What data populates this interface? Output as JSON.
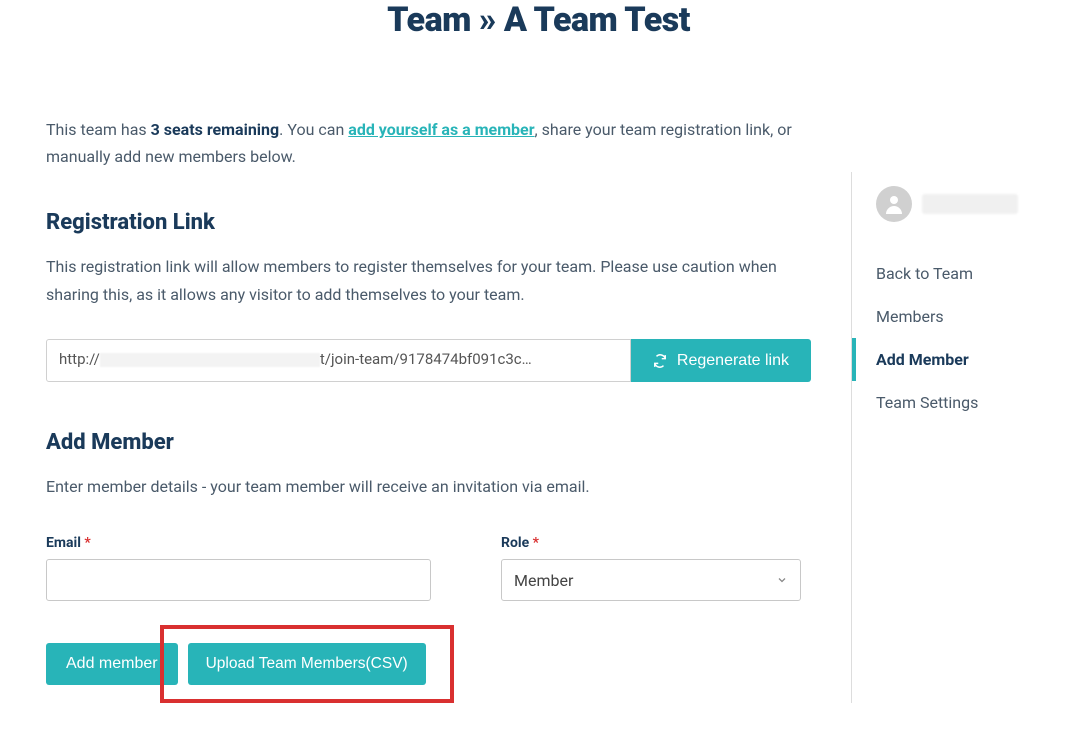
{
  "page_title": "Team » A Team Test",
  "intro": {
    "prefix": "This team has ",
    "seats_bold": "3 seats remaining",
    "mid": ". You can ",
    "link_text": "add yourself as a member",
    "suffix": ", share your team registration link, or manually add new members below."
  },
  "registration": {
    "heading": "Registration Link",
    "desc": "This registration link will allow members to register themselves for your team. Please use caution when sharing this, as it allows any visitor to add themselves to your team.",
    "url_prefix": "http://",
    "url_suffix": "t/join-team/9178474bf091c3c…",
    "regen_label": "Regenerate link"
  },
  "add_member": {
    "heading": "Add Member",
    "desc": "Enter member details - your team member will receive an invitation via email.",
    "email_label": "Email",
    "role_label": "Role",
    "role_value": "Member",
    "add_button": "Add member",
    "upload_button": "Upload Team Members(CSV)"
  },
  "sidebar": {
    "items": [
      {
        "label": "Back to Team",
        "active": false
      },
      {
        "label": "Members",
        "active": false
      },
      {
        "label": "Add Member",
        "active": true
      },
      {
        "label": "Team Settings",
        "active": false
      }
    ]
  }
}
